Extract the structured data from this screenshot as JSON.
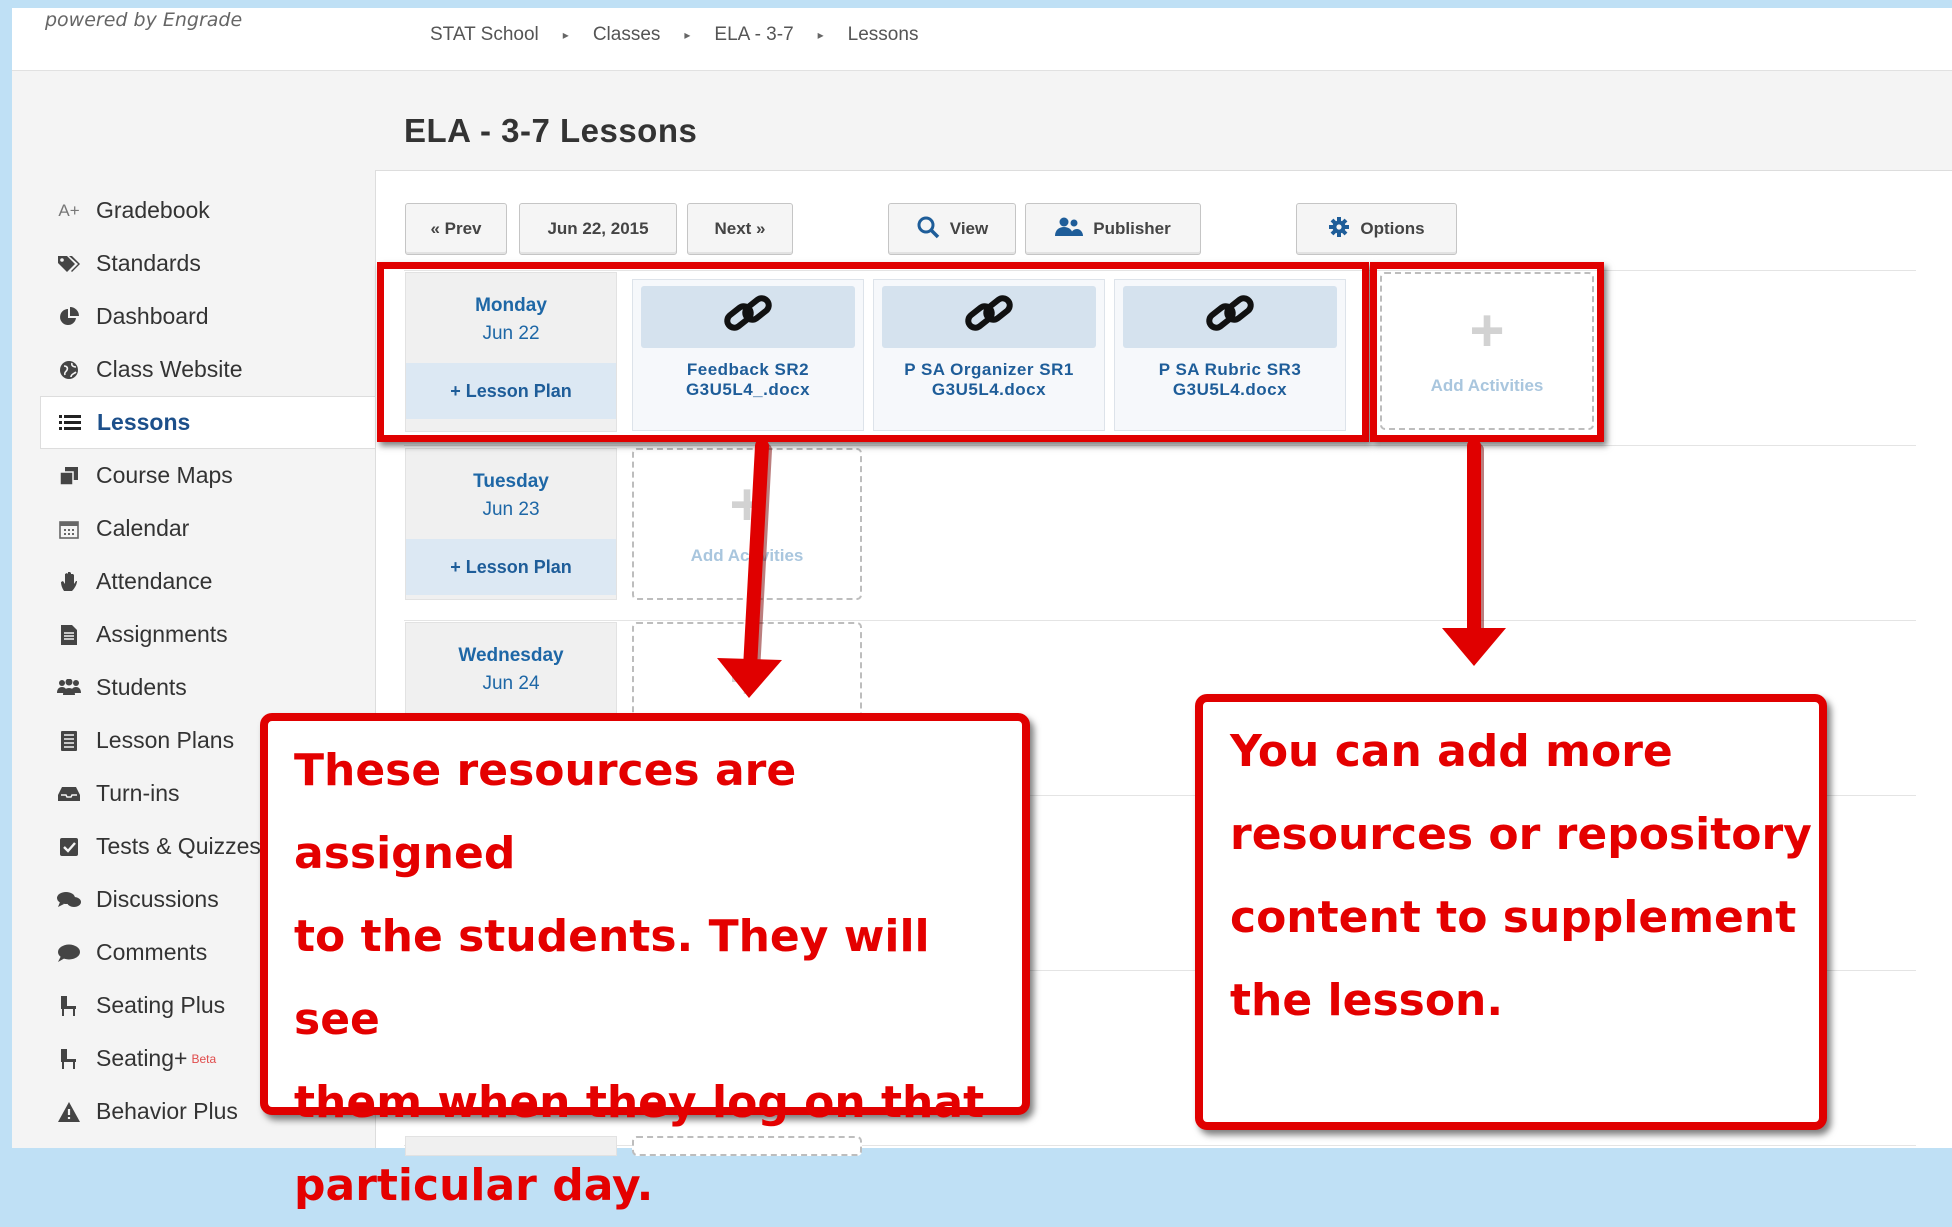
{
  "topbar": {
    "powered_by": "powered by Engrade",
    "breadcrumb": [
      "STAT School",
      "Classes",
      "ELA - 3-7",
      "Lessons"
    ]
  },
  "page_title": "ELA - 3-7 Lessons",
  "sidebar": {
    "items": [
      {
        "label": "Gradebook",
        "icon": "grade-icon"
      },
      {
        "label": "Standards",
        "icon": "tags-icon"
      },
      {
        "label": "Dashboard",
        "icon": "pie-chart-icon"
      },
      {
        "label": "Class Website",
        "icon": "globe-icon"
      },
      {
        "label": "Lessons",
        "icon": "list-icon",
        "active": true
      },
      {
        "label": "Course Maps",
        "icon": "copy-icon"
      },
      {
        "label": "Calendar",
        "icon": "calendar-icon"
      },
      {
        "label": "Attendance",
        "icon": "hand-icon"
      },
      {
        "label": "Assignments",
        "icon": "document-icon"
      },
      {
        "label": "Students",
        "icon": "group-icon"
      },
      {
        "label": "Lesson Plans",
        "icon": "notebook-icon"
      },
      {
        "label": "Turn-ins",
        "icon": "inbox-icon"
      },
      {
        "label": "Tests & Quizzes",
        "icon": "checkbox-icon"
      },
      {
        "label": "Discussions",
        "icon": "chat-bubbles-icon"
      },
      {
        "label": "Comments",
        "icon": "comment-icon"
      },
      {
        "label": "Seating Plus",
        "icon": "chair-icon"
      },
      {
        "label": "Seating+",
        "icon": "chair-icon",
        "badge": "Beta"
      },
      {
        "label": "Behavior Plus",
        "icon": "warning-icon"
      }
    ]
  },
  "toolbar": {
    "prev": "« Prev",
    "date": "Jun 22, 2015",
    "next": "Next »",
    "view": "View",
    "publisher": "Publisher",
    "options": "Options"
  },
  "days": [
    {
      "name": "Monday",
      "date": "Jun 22",
      "plan": "+ Lesson Plan"
    },
    {
      "name": "Tuesday",
      "date": "Jun 23",
      "plan": "+ Lesson Plan"
    },
    {
      "name": "Wednesday",
      "date": "Jun 24"
    }
  ],
  "resources": [
    {
      "line1": "Feedback SR2",
      "line2": "G3U5L4_.docx",
      "icon": "link-icon"
    },
    {
      "line1": "P SA Organizer SR1",
      "line2": "G3U5L4.docx",
      "icon": "link-icon"
    },
    {
      "line1": "P SA Rubric SR3",
      "line2": "G3U5L4.docx",
      "icon": "link-icon"
    }
  ],
  "add_activities": "Add Activities",
  "callouts": {
    "left": [
      "These resources are assigned",
      "to the students. They will see",
      "them when they log on that",
      "particular day."
    ],
    "right": [
      "You can add more",
      "resources or repository",
      "content to supplement",
      "the lesson."
    ]
  },
  "colors": {
    "annotation_red": "#e00000",
    "link_blue": "#1e67a6",
    "active_blue": "#1c4f8a"
  }
}
